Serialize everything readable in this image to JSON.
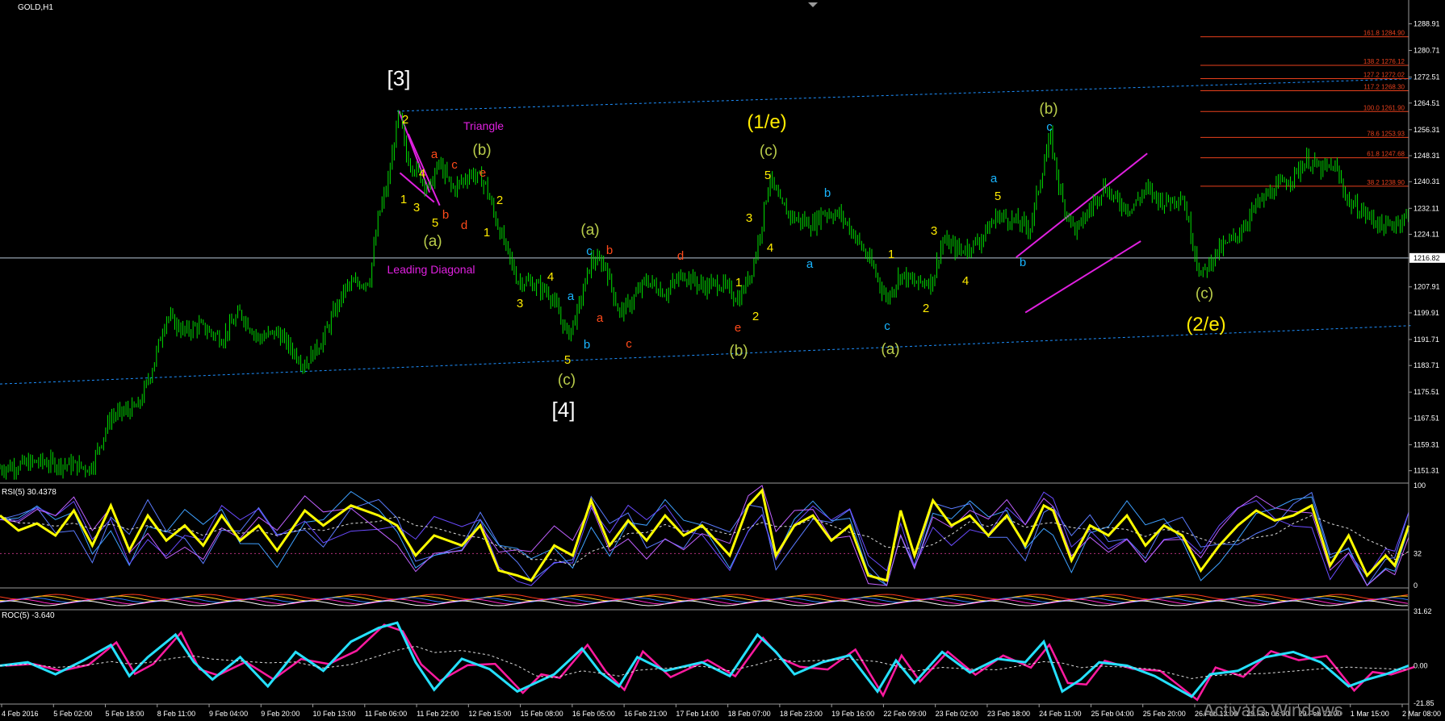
{
  "symbol": "GOLD,H1",
  "indicators": {
    "rsi_label": "RSI(5) 30.4378",
    "roc_label": "ROC(5) -3.640",
    "rsi_levels": [
      "100",
      "32",
      "0"
    ],
    "roc_levels": [
      "31.62",
      "0.00",
      "-21.85"
    ]
  },
  "watermark": "Activate Windows",
  "colors": {
    "background": "#000000",
    "candles": "#00e000",
    "wave_yellow": "#ffeb00",
    "wave_olive": "#b9cc4a",
    "wave_orange": "#ff4a1a",
    "wave_cyan": "#19b5ff",
    "wave_white": "#ffffff",
    "channel": "#1e90ff",
    "magenta": "#e020e0",
    "fib": "#e8401c",
    "rsi_main": "#ffff00",
    "roc_pink": "#ff1aa0",
    "roc_cyan": "#25e0ff"
  },
  "price_axis": [
    "1288.91",
    "1280.71",
    "1272.51",
    "1264.51",
    "1256.31",
    "1248.31",
    "1240.31",
    "1232.11",
    "1224.11",
    "1216.82",
    "1207.91",
    "1199.91",
    "1191.71",
    "1183.71",
    "1175.51",
    "1167.51",
    "1159.31",
    "1151.31"
  ],
  "current_price": "1216.82",
  "time_axis": [
    "4 Feb 2016",
    "5 Feb 02:00",
    "5 Feb 18:00",
    "8 Feb 11:00",
    "9 Feb 04:00",
    "9 Feb 20:00",
    "10 Feb 13:00",
    "11 Feb 06:00",
    "11 Feb 22:00",
    "12 Feb 15:00",
    "15 Feb 08:00",
    "16 Feb 05:00",
    "16 Feb 21:00",
    "17 Feb 14:00",
    "18 Feb 07:00",
    "18 Feb 23:00",
    "19 Feb 16:00",
    "22 Feb 09:00",
    "23 Feb 02:00",
    "23 Feb 18:00",
    "24 Feb 11:00",
    "25 Feb 04:00",
    "25 Feb 20:00",
    "26 Feb 13:00",
    "29 Feb 06:00",
    "29 Feb 22:00",
    "1 Mar 15:00",
    "2 Mar 08:00"
  ],
  "fib_levels": [
    {
      "label": "161.8  1284.90",
      "price": 1284.9
    },
    {
      "label": "138.2  1276.12",
      "price": 1276.12
    },
    {
      "label": "127.2  1272.02",
      "price": 1272.02
    },
    {
      "label": "117.2  1268.30",
      "price": 1268.3
    },
    {
      "label": "100.0  1261.90",
      "price": 1261.9
    },
    {
      "label": "78.6  1253.93",
      "price": 1253.93
    },
    {
      "label": "61.8  1247.68",
      "price": 1247.68
    },
    {
      "label": "38.2  1238.90",
      "price": 1238.9
    }
  ],
  "wave_labels": [
    {
      "text": "[3]",
      "color": "wave_white",
      "size": 26,
      "bar": 1
    },
    {
      "text": "[4]",
      "color": "wave_white",
      "size": 26,
      "bar": 2
    },
    {
      "text": "(1/e)",
      "color": "wave_yellow",
      "size": 24,
      "bar": 3
    },
    {
      "text": "(2/e)",
      "color": "wave_yellow",
      "size": 24,
      "bar": 4
    },
    {
      "text": "Triangle",
      "color": "magenta",
      "size": 14,
      "bar": 5
    },
    {
      "text": "Leading Diagonal",
      "color": "magenta",
      "size": 14,
      "bar": 6
    },
    {
      "text": "(b)",
      "color": "wave_olive",
      "size": 19,
      "bar": 7
    },
    {
      "text": "(a)",
      "color": "wave_olive",
      "size": 19,
      "bar": 8
    },
    {
      "text": "(a)",
      "color": "wave_olive",
      "size": 19,
      "bar": 9
    },
    {
      "text": "(c)",
      "color": "wave_olive",
      "size": 19,
      "bar": 10
    },
    {
      "text": "(c)",
      "color": "wave_olive",
      "size": 19,
      "bar": 11
    },
    {
      "text": "(b)",
      "color": "wave_olive",
      "size": 19,
      "bar": 12
    },
    {
      "text": "(a)",
      "color": "wave_olive",
      "size": 19,
      "bar": 13
    },
    {
      "text": "(b)",
      "color": "wave_olive",
      "size": 19,
      "bar": 14
    },
    {
      "text": "(c)",
      "color": "wave_olive",
      "size": 19,
      "bar": 15
    },
    {
      "text": "2",
      "color": "wave_yellow",
      "size": 15,
      "bar": 16
    },
    {
      "text": "1",
      "color": "wave_yellow",
      "size": 15,
      "bar": 17
    },
    {
      "text": "3",
      "color": "wave_yellow",
      "size": 15,
      "bar": 18
    },
    {
      "text": "4",
      "color": "wave_yellow",
      "size": 15,
      "bar": 19
    },
    {
      "text": "5",
      "color": "wave_yellow",
      "size": 15,
      "bar": 20
    },
    {
      "text": "a",
      "color": "wave_orange",
      "size": 15,
      "bar": 21
    },
    {
      "text": "b",
      "color": "wave_orange",
      "size": 15,
      "bar": 22
    },
    {
      "text": "c",
      "color": "wave_orange",
      "size": 15,
      "bar": 23
    },
    {
      "text": "d",
      "color": "wave_orange",
      "size": 15,
      "bar": 24
    },
    {
      "text": "e",
      "color": "wave_orange",
      "size": 15,
      "bar": 25
    },
    {
      "text": "2",
      "color": "wave_yellow",
      "size": 15,
      "bar": 26
    },
    {
      "text": "1",
      "color": "wave_yellow",
      "size": 15,
      "bar": 27
    },
    {
      "text": "3",
      "color": "wave_yellow",
      "size": 15,
      "bar": 28
    },
    {
      "text": "4",
      "color": "wave_yellow",
      "size": 15,
      "bar": 29
    },
    {
      "text": "5",
      "color": "wave_yellow",
      "size": 15,
      "bar": 30
    },
    {
      "text": "a",
      "color": "wave_cyan",
      "size": 15,
      "bar": 31
    },
    {
      "text": "b",
      "color": "wave_cyan",
      "size": 15,
      "bar": 32
    },
    {
      "text": "c",
      "color": "wave_cyan",
      "size": 15,
      "bar": 33
    },
    {
      "text": "b",
      "color": "wave_orange",
      "size": 15,
      "bar": 34
    },
    {
      "text": "a",
      "color": "wave_orange",
      "size": 15,
      "bar": 35
    },
    {
      "text": "c",
      "color": "wave_orange",
      "size": 15,
      "bar": 36
    },
    {
      "text": "d",
      "color": "wave_orange",
      "size": 15,
      "bar": 37
    },
    {
      "text": "e",
      "color": "wave_orange",
      "size": 15,
      "bar": 38
    },
    {
      "text": "1",
      "color": "wave_yellow",
      "size": 15,
      "bar": 39
    },
    {
      "text": "2",
      "color": "wave_yellow",
      "size": 15,
      "bar": 40
    },
    {
      "text": "3",
      "color": "wave_yellow",
      "size": 15,
      "bar": 41
    },
    {
      "text": "4",
      "color": "wave_yellow",
      "size": 15,
      "bar": 42
    },
    {
      "text": "5",
      "color": "wave_yellow",
      "size": 15,
      "bar": 43
    },
    {
      "text": "a",
      "color": "wave_cyan",
      "size": 15,
      "bar": 44
    },
    {
      "text": "b",
      "color": "wave_cyan",
      "size": 15,
      "bar": 45
    },
    {
      "text": "c",
      "color": "wave_cyan",
      "size": 15,
      "bar": 46
    },
    {
      "text": "1",
      "color": "wave_yellow",
      "size": 15,
      "bar": 47
    },
    {
      "text": "2",
      "color": "wave_yellow",
      "size": 15,
      "bar": 48
    },
    {
      "text": "3",
      "color": "wave_yellow",
      "size": 15,
      "bar": 49
    },
    {
      "text": "4",
      "color": "wave_yellow",
      "size": 15,
      "bar": 50
    },
    {
      "text": "5",
      "color": "wave_yellow",
      "size": 15,
      "bar": 51
    },
    {
      "text": "a",
      "color": "wave_cyan",
      "size": 15,
      "bar": 52
    },
    {
      "text": "b",
      "color": "wave_cyan",
      "size": 15,
      "bar": 53
    },
    {
      "text": "c",
      "color": "wave_cyan",
      "size": 15,
      "bar": 54
    }
  ],
  "chart_data": {
    "type": "line",
    "title": "GOLD,H1",
    "ylim": [
      1148,
      1295
    ],
    "x_range": [
      "4 Feb 2016",
      "2 Mar 08:00"
    ],
    "x_index_range": [
      0,
      1525
    ],
    "price_path": [
      [
        0,
        1152
      ],
      [
        40,
        1154
      ],
      [
        80,
        1153
      ],
      [
        98,
        1152
      ],
      [
        120,
        1168
      ],
      [
        150,
        1171
      ],
      [
        165,
        1183
      ],
      [
        180,
        1199
      ],
      [
        200,
        1194
      ],
      [
        215,
        1196
      ],
      [
        240,
        1192
      ],
      [
        260,
        1200
      ],
      [
        280,
        1192
      ],
      [
        300,
        1194
      ],
      [
        330,
        1184
      ],
      [
        350,
        1192
      ],
      [
        360,
        1199
      ],
      [
        375,
        1208
      ],
      [
        400,
        1210
      ],
      [
        410,
        1230
      ],
      [
        420,
        1240
      ],
      [
        432,
        1262
      ],
      [
        440,
        1248
      ],
      [
        450,
        1244
      ],
      [
        465,
        1238
      ],
      [
        475,
        1246
      ],
      [
        490,
        1238
      ],
      [
        510,
        1243
      ],
      [
        525,
        1240
      ],
      [
        535,
        1230
      ],
      [
        545,
        1222
      ],
      [
        560,
        1210
      ],
      [
        575,
        1209
      ],
      [
        595,
        1206
      ],
      [
        615,
        1193
      ],
      [
        625,
        1200
      ],
      [
        640,
        1216
      ],
      [
        655,
        1215
      ],
      [
        670,
        1200
      ],
      [
        680,
        1202
      ],
      [
        700,
        1210
      ],
      [
        720,
        1206
      ],
      [
        740,
        1212
      ],
      [
        760,
        1208
      ],
      [
        780,
        1209
      ],
      [
        800,
        1204
      ],
      [
        815,
        1214
      ],
      [
        825,
        1228
      ],
      [
        833,
        1242
      ],
      [
        845,
        1233
      ],
      [
        860,
        1229
      ],
      [
        880,
        1227
      ],
      [
        890,
        1231
      ],
      [
        910,
        1230
      ],
      [
        925,
        1224
      ],
      [
        945,
        1214
      ],
      [
        960,
        1204
      ],
      [
        975,
        1212
      ],
      [
        990,
        1209
      ],
      [
        1010,
        1210
      ],
      [
        1020,
        1222
      ],
      [
        1040,
        1219
      ],
      [
        1060,
        1222
      ],
      [
        1080,
        1230
      ],
      [
        1100,
        1228
      ],
      [
        1115,
        1226
      ],
      [
        1130,
        1246
      ],
      [
        1137,
        1254
      ],
      [
        1150,
        1234
      ],
      [
        1165,
        1225
      ],
      [
        1180,
        1232
      ],
      [
        1195,
        1239
      ],
      [
        1210,
        1234
      ],
      [
        1225,
        1232
      ],
      [
        1240,
        1238
      ],
      [
        1260,
        1234
      ],
      [
        1280,
        1236
      ],
      [
        1300,
        1211
      ],
      [
        1315,
        1218
      ],
      [
        1340,
        1224
      ],
      [
        1360,
        1233
      ],
      [
        1380,
        1238
      ],
      [
        1400,
        1242
      ],
      [
        1415,
        1247
      ],
      [
        1430,
        1244
      ],
      [
        1445,
        1245
      ],
      [
        1460,
        1234
      ],
      [
        1480,
        1230
      ],
      [
        1500,
        1226
      ],
      [
        1525,
        1230
      ]
    ],
    "resistance_channel": [
      [
        430,
        1262
      ],
      [
        1528,
        1272
      ]
    ],
    "support_channel": [
      [
        0,
        1178
      ],
      [
        1528,
        1196
      ]
    ],
    "horizontal_line": 1216.82,
    "rsi_ylim": [
      0,
      100
    ],
    "rsi_path": [
      [
        0,
        70
      ],
      [
        20,
        55
      ],
      [
        40,
        62
      ],
      [
        60,
        50
      ],
      [
        80,
        75
      ],
      [
        100,
        40
      ],
      [
        120,
        80
      ],
      [
        140,
        35
      ],
      [
        160,
        70
      ],
      [
        180,
        45
      ],
      [
        200,
        60
      ],
      [
        220,
        40
      ],
      [
        240,
        70
      ],
      [
        260,
        45
      ],
      [
        280,
        60
      ],
      [
        300,
        35
      ],
      [
        330,
        75
      ],
      [
        350,
        60
      ],
      [
        380,
        80
      ],
      [
        410,
        70
      ],
      [
        430,
        60
      ],
      [
        450,
        30
      ],
      [
        470,
        50
      ],
      [
        500,
        40
      ],
      [
        520,
        60
      ],
      [
        540,
        15
      ],
      [
        560,
        10
      ],
      [
        575,
        5
      ],
      [
        600,
        40
      ],
      [
        620,
        30
      ],
      [
        640,
        85
      ],
      [
        660,
        40
      ],
      [
        680,
        65
      ],
      [
        700,
        45
      ],
      [
        720,
        70
      ],
      [
        740,
        50
      ],
      [
        760,
        60
      ],
      [
        790,
        30
      ],
      [
        810,
        80
      ],
      [
        825,
        95
      ],
      [
        840,
        30
      ],
      [
        860,
        60
      ],
      [
        880,
        70
      ],
      [
        900,
        45
      ],
      [
        920,
        60
      ],
      [
        940,
        10
      ],
      [
        960,
        5
      ],
      [
        975,
        75
      ],
      [
        990,
        30
      ],
      [
        1010,
        85
      ],
      [
        1030,
        60
      ],
      [
        1050,
        70
      ],
      [
        1070,
        50
      ],
      [
        1090,
        70
      ],
      [
        1110,
        40
      ],
      [
        1130,
        80
      ],
      [
        1140,
        75
      ],
      [
        1160,
        25
      ],
      [
        1180,
        60
      ],
      [
        1200,
        50
      ],
      [
        1220,
        70
      ],
      [
        1240,
        40
      ],
      [
        1260,
        60
      ],
      [
        1280,
        50
      ],
      [
        1300,
        15
      ],
      [
        1320,
        40
      ],
      [
        1340,
        60
      ],
      [
        1360,
        75
      ],
      [
        1380,
        65
      ],
      [
        1400,
        70
      ],
      [
        1420,
        80
      ],
      [
        1440,
        20
      ],
      [
        1460,
        50
      ],
      [
        1480,
        10
      ],
      [
        1500,
        30
      ],
      [
        1510,
        20
      ],
      [
        1525,
        60
      ]
    ],
    "roc_ylim": [
      -21.85,
      31.62
    ],
    "roc_path": [
      [
        0,
        0
      ],
      [
        30,
        2
      ],
      [
        60,
        -5
      ],
      [
        90,
        3
      ],
      [
        120,
        12
      ],
      [
        140,
        -6
      ],
      [
        160,
        5
      ],
      [
        190,
        18
      ],
      [
        210,
        2
      ],
      [
        230,
        -8
      ],
      [
        260,
        5
      ],
      [
        290,
        -12
      ],
      [
        320,
        8
      ],
      [
        350,
        -3
      ],
      [
        380,
        14
      ],
      [
        410,
        22
      ],
      [
        430,
        25
      ],
      [
        450,
        2
      ],
      [
        470,
        -14
      ],
      [
        500,
        4
      ],
      [
        530,
        -2
      ],
      [
        560,
        -15
      ],
      [
        580,
        -10
      ],
      [
        600,
        -5
      ],
      [
        630,
        10
      ],
      [
        650,
        -4
      ],
      [
        670,
        -12
      ],
      [
        690,
        5
      ],
      [
        720,
        -3
      ],
      [
        760,
        2
      ],
      [
        790,
        -6
      ],
      [
        820,
        18
      ],
      [
        840,
        8
      ],
      [
        860,
        -5
      ],
      [
        890,
        2
      ],
      [
        920,
        6
      ],
      [
        950,
        -15
      ],
      [
        970,
        3
      ],
      [
        990,
        -10
      ],
      [
        1020,
        8
      ],
      [
        1050,
        -4
      ],
      [
        1080,
        4
      ],
      [
        1110,
        2
      ],
      [
        1130,
        14
      ],
      [
        1150,
        -15
      ],
      [
        1170,
        -8
      ],
      [
        1190,
        2
      ],
      [
        1220,
        0
      ],
      [
        1250,
        -6
      ],
      [
        1290,
        -18
      ],
      [
        1310,
        -5
      ],
      [
        1340,
        -3
      ],
      [
        1370,
        5
      ],
      [
        1400,
        8
      ],
      [
        1430,
        2
      ],
      [
        1460,
        -12
      ],
      [
        1480,
        -8
      ],
      [
        1500,
        -5
      ],
      [
        1525,
        0
      ]
    ],
    "grid": false
  }
}
